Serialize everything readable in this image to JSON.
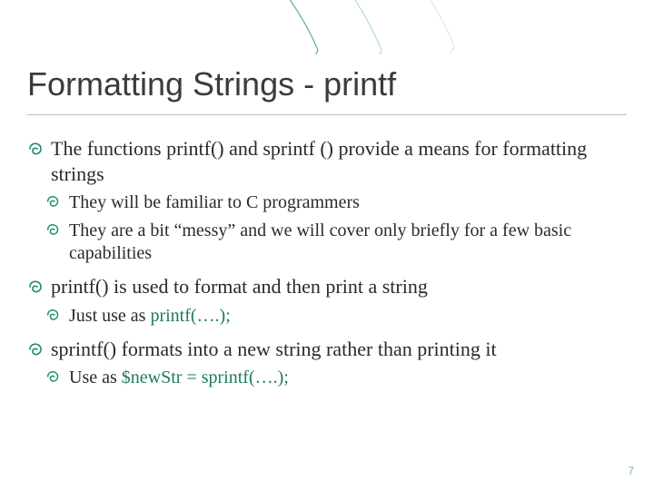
{
  "title": "Formatting Strings - printf",
  "bullets": {
    "b1": "The functions printf() and sprintf () provide a means for formatting strings",
    "b1a": "They will be familiar to C programmers",
    "b1b": "They are a bit “messy” and we will cover only briefly for a few basic capabilities",
    "b2": "printf() is used to format and then print a string",
    "b2a_pre": "Just use as ",
    "b2a_code": "printf(….);",
    "b3": "sprintf() formats into a new string rather than printing it",
    "b3a_pre": "Use as ",
    "b3a_code": "$newStr = sprintf(….);"
  },
  "page_number": "7"
}
